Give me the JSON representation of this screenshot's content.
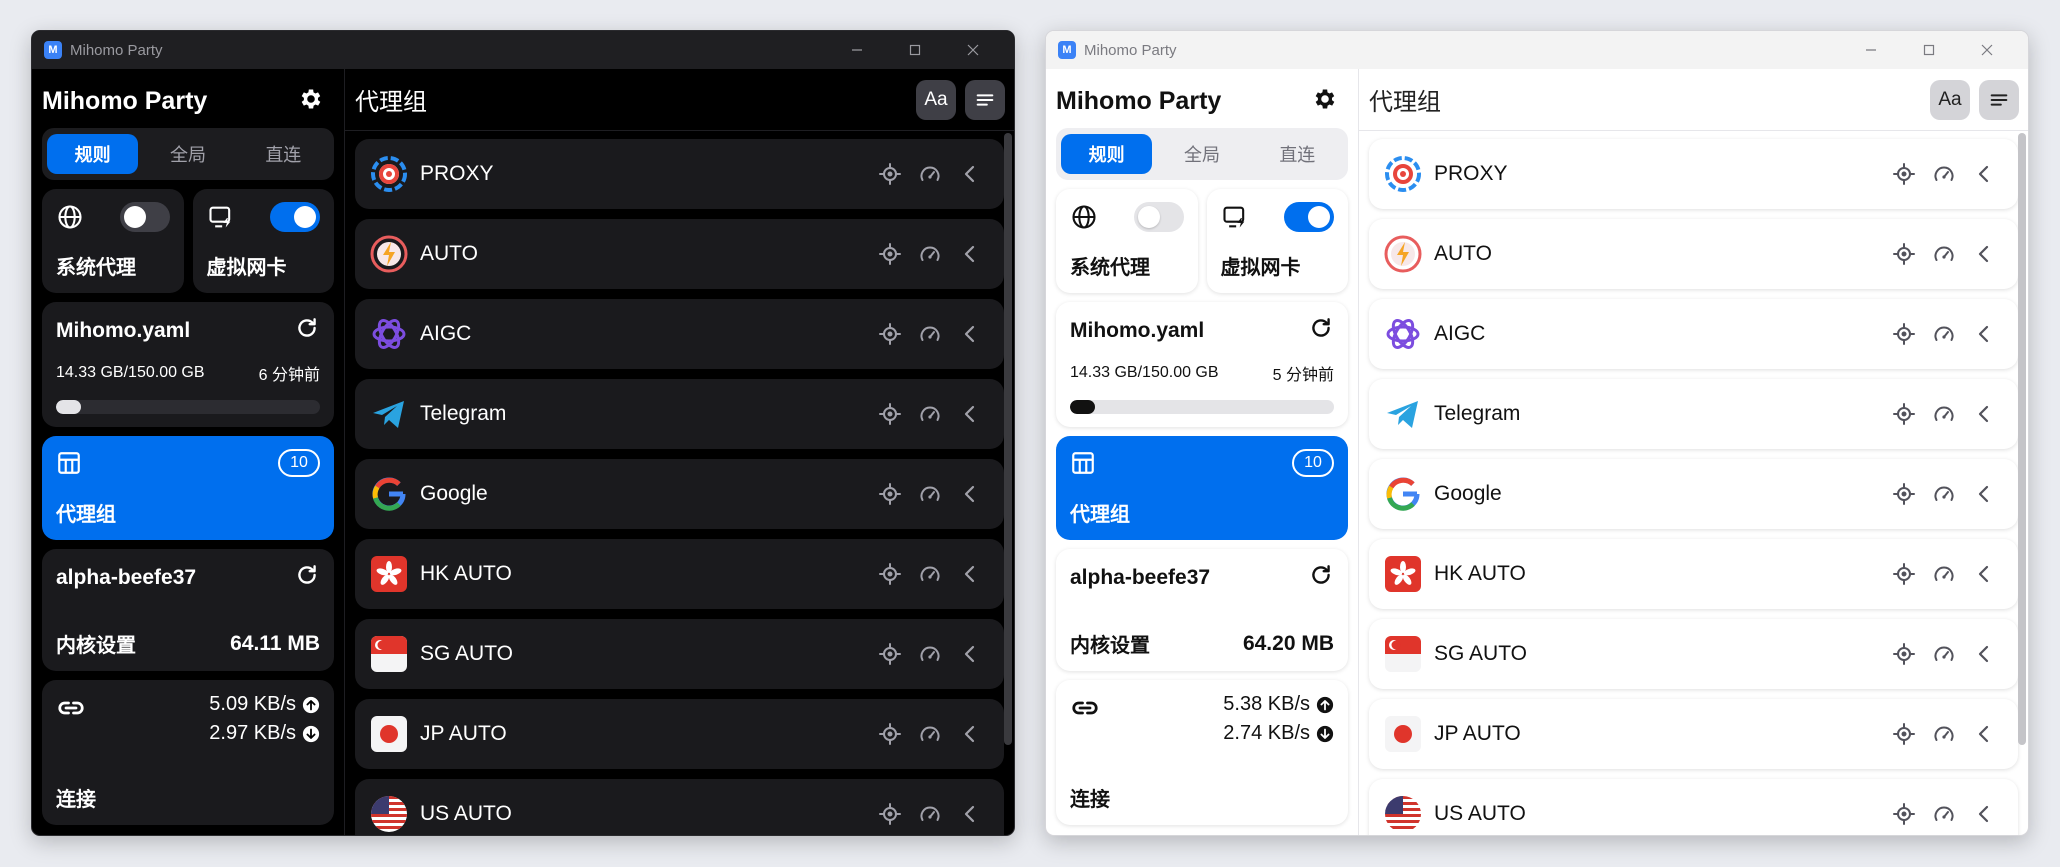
{
  "app": {
    "title": "Mihomo Party",
    "logo_letter": "M"
  },
  "sidebar": {
    "brand": "Mihomo Party",
    "modes": [
      "规则",
      "全局",
      "直连"
    ],
    "active_mode": "规则",
    "sysproxy_label": "系统代理",
    "tun_label": "虚拟网卡",
    "profile_name": "Mihomo.yaml",
    "proxygroup_label": "代理组",
    "proxygroup_count": "10",
    "core_version": "alpha-beefe37",
    "core_label": "内核设置",
    "connection_label": "连接"
  },
  "main": {
    "title": "代理组",
    "font_btn": "Aa"
  },
  "groups": [
    {
      "name": "PROXY",
      "icon": "proxy-icon"
    },
    {
      "name": "AUTO",
      "icon": "auto-icon"
    },
    {
      "name": "AIGC",
      "icon": "openai-icon"
    },
    {
      "name": "Telegram",
      "icon": "telegram-icon"
    },
    {
      "name": "Google",
      "icon": "google-icon"
    },
    {
      "name": "HK AUTO",
      "icon": "hk-flag-icon"
    },
    {
      "name": "SG AUTO",
      "icon": "sg-flag-icon"
    },
    {
      "name": "JP AUTO",
      "icon": "jp-flag-icon"
    },
    {
      "name": "US AUTO",
      "icon": "us-flag-icon"
    }
  ],
  "dark": {
    "sysproxy_on": false,
    "tun_on": true,
    "profile_usage": "14.33 GB/150.00 GB",
    "profile_updated": "6 分钟前",
    "profile_usage_pct": 9.55,
    "core_memory": "64.11 MB",
    "upload": "5.09 KB/s",
    "download": "2.97 KB/s"
  },
  "light": {
    "sysproxy_on": false,
    "tun_on": true,
    "profile_usage": "14.33 GB/150.00 GB",
    "profile_updated": "5 分钟前",
    "profile_usage_pct": 9.55,
    "core_memory": "64.20 MB",
    "upload": "5.38 KB/s",
    "download": "2.74 KB/s"
  },
  "colors": {
    "accent": "#006fee"
  }
}
